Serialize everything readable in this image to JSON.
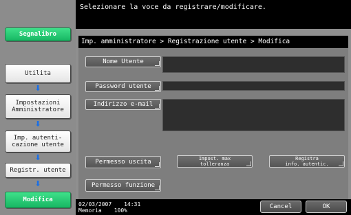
{
  "header": {
    "message": "Selezionare la voce da registrare/modificare."
  },
  "sidebar": {
    "bookmark_label": "Segnalibro",
    "items": [
      {
        "label": "Utilita"
      },
      {
        "label": "Impostazioni\nAmministratore"
      },
      {
        "label": "Imp. autenti-\ncazione utente"
      },
      {
        "label": "Registr. utente"
      },
      {
        "label": "Modifica"
      }
    ]
  },
  "breadcrumb": "Imp. amministratore > Registrazione utente > Modifica",
  "form": {
    "user_name_label": "Nome Utente",
    "user_name_value": "",
    "password_label": "Password utente",
    "password_value": "",
    "email_label": "Indirizzo e-mail",
    "email_value": ""
  },
  "actions": {
    "output_permission": "Permesso uscita",
    "max_tolerance": "Impost. max\ntolleranza",
    "register_auth_info": "Registra\ninfo. autentic.",
    "function_permission": "Permesso funzione"
  },
  "status": {
    "date": "02/03/2007",
    "time": "14:31",
    "memory_label": "Memoria",
    "memory_value": "100%"
  },
  "footer": {
    "cancel_label": "Cancel",
    "ok_label": "OK"
  },
  "colors": {
    "accent_green": "#17b763",
    "arrow_blue": "#1a6fe6",
    "panel_gray": "#7e7e7e"
  }
}
